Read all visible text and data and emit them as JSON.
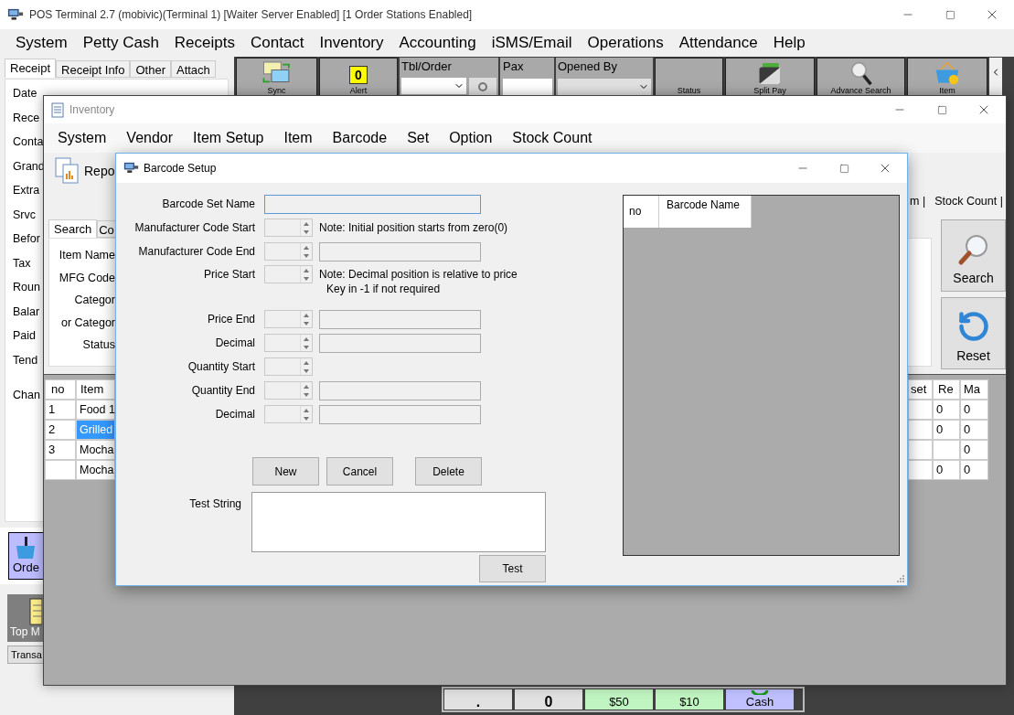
{
  "pos": {
    "title": "POS Terminal 2.7 (mobivic)(Terminal 1) [Waiter Server Enabled] [1 Order Stations Enabled]",
    "menu": [
      "System",
      "Petty Cash",
      "Receipts",
      "Contact",
      "Inventory",
      "Accounting",
      "iSMS/Email",
      "Operations",
      "Attendance",
      "Help"
    ],
    "tabs": [
      {
        "label": "Receipt",
        "selected": true
      },
      {
        "label": "Receipt Info",
        "selected": false
      },
      {
        "label": "Other",
        "selected": false
      },
      {
        "label": "Attach",
        "selected": false
      }
    ],
    "fields": [
      "Date",
      "Rece",
      "Conta",
      "Grand",
      "Extra",
      "Srvc",
      "Befor",
      "Tax",
      "Roun",
      "Balar",
      "Paid",
      "Tend",
      "Chan"
    ],
    "toolbar": [
      {
        "kind": "button",
        "label": "Sync"
      },
      {
        "kind": "alert",
        "label": "Alert",
        "badge": "0"
      },
      {
        "kind": "combo_search",
        "label": "Tbl/Order"
      },
      {
        "kind": "input",
        "label": "Pax"
      },
      {
        "kind": "combo",
        "label": "Opened By"
      },
      {
        "kind": "button",
        "label": "Status"
      },
      {
        "kind": "button",
        "label": "Split Pay"
      },
      {
        "kind": "button",
        "label": "Advance Search"
      },
      {
        "kind": "button",
        "label": "Item"
      }
    ],
    "side_buttons": [
      {
        "kind": "order",
        "label": "Orde"
      },
      {
        "kind": "top",
        "label": "Top M"
      },
      {
        "kind": "plain",
        "label": "Transa"
      }
    ],
    "keypad": [
      {
        "kind": "plain",
        "label": "."
      },
      {
        "kind": "plain",
        "label": "0"
      },
      {
        "kind": "cash",
        "label": "$50"
      },
      {
        "kind": "cash",
        "label": "$10"
      },
      {
        "kind": "tender",
        "label": "Cash"
      }
    ]
  },
  "inventory": {
    "title": "Inventory",
    "menu": [
      "System",
      "Vendor",
      "Item Setup",
      "Item",
      "Barcode",
      "Set",
      "Option",
      "Stock Count"
    ],
    "toolbar": "Repo",
    "links": [
      "m |",
      "Stock Count |"
    ],
    "tabs": [
      {
        "label": "Search",
        "selected": true
      },
      {
        "label": "Co",
        "selected": false
      }
    ],
    "search_labels": [
      "Item Name",
      "MFG Code",
      "Categor",
      "or Categor",
      "Status"
    ],
    "buttons": [
      "Search",
      "Reset"
    ],
    "grid": {
      "columns": [
        "no",
        "Item",
        "set",
        "Re",
        "Ma"
      ],
      "rows": [
        {
          "no": "1",
          "item": "Food 1",
          "rec": "0",
          "max": "0",
          "selected": false
        },
        {
          "no": "2",
          "item": "Grilled",
          "rec": "0",
          "max": "0",
          "selected": true
        },
        {
          "no": "3",
          "item": "Mocha",
          "max": "0",
          "selected": false
        },
        {
          "item": "Mocha",
          "rec": "0",
          "max": "0",
          "selected": false
        }
      ]
    }
  },
  "barcode_setup": {
    "title": "Barcode Setup",
    "fields": [
      {
        "kind": "text",
        "label": "Barcode Set Name"
      },
      {
        "kind": "spin_note",
        "label": "Manufacturer Code Start",
        "note": [
          "Note: Initial position starts from zero(0)"
        ]
      },
      {
        "kind": "spin_text",
        "label": "Manufacturer Code End"
      },
      {
        "kind": "spin_note",
        "label": "Price Start",
        "note": [
          "Note: Decimal position is relative to price",
          "Key in -1 if not required"
        ]
      },
      {
        "kind": "spin_text",
        "label": "Price End"
      },
      {
        "kind": "spin_text",
        "label": "Decimal"
      },
      {
        "kind": "spin",
        "label": "Quantity Start"
      },
      {
        "kind": "spin_text",
        "label": "Quantity End"
      },
      {
        "kind": "spin_text",
        "label": "Decimal"
      }
    ],
    "buttons": [
      "New",
      "Cancel",
      "Delete"
    ],
    "test_label": "Test String",
    "test_button": "Test",
    "list_columns": [
      "no",
      "Barcode Name"
    ]
  }
}
